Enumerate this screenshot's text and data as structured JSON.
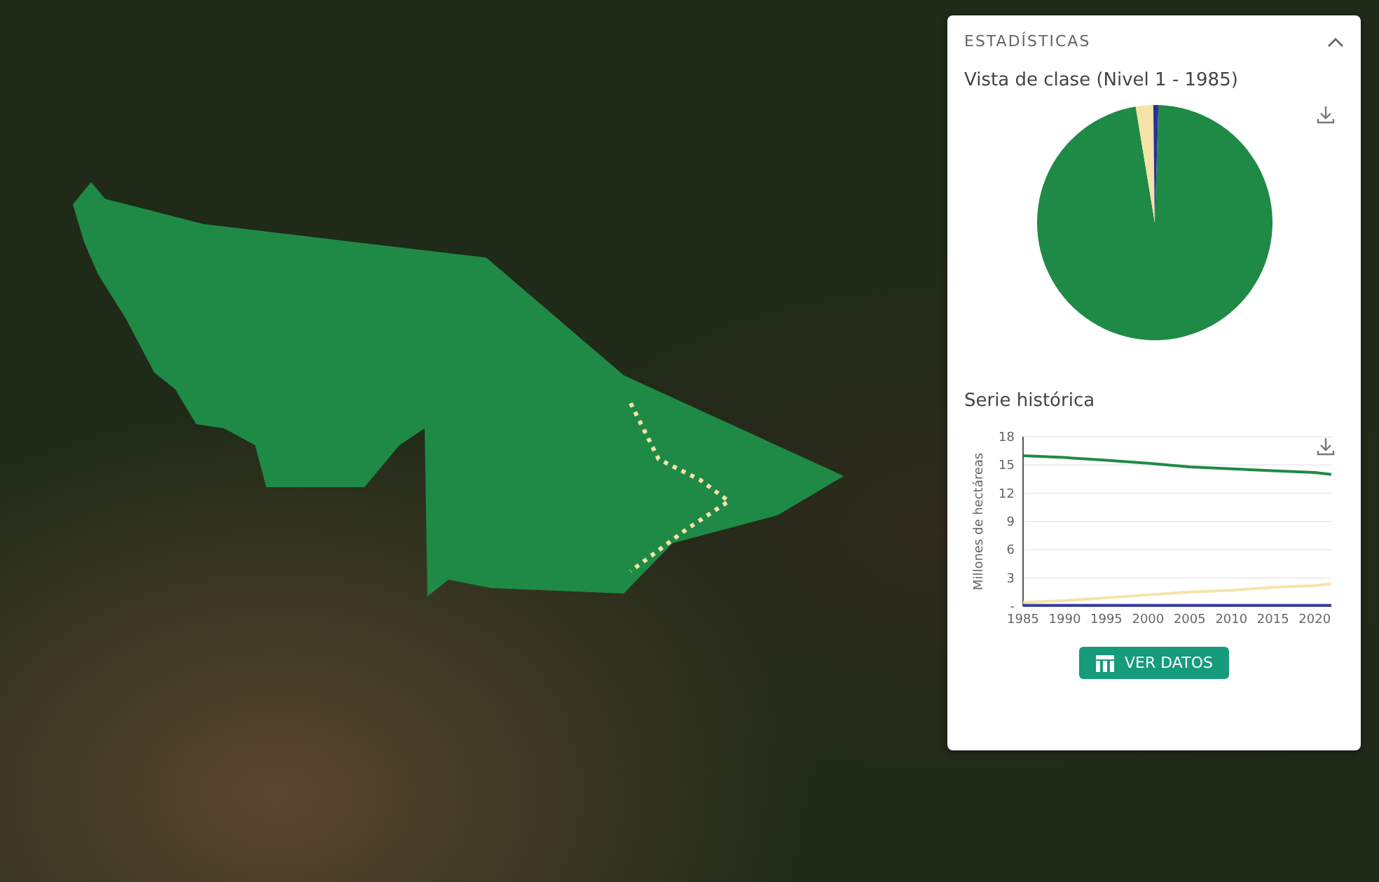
{
  "panel": {
    "title": "ESTADÍSTICAS",
    "expanded": true,
    "pie": {
      "title": "Vista de clase (Nivel 1 - 1985)"
    },
    "history": {
      "title": "Serie histórica",
      "chart_data": {
        "type": "line",
        "ylabel": "Millones de hectáreas",
        "x": [
          1985,
          1990,
          1995,
          2000,
          2005,
          2010,
          2015,
          2020,
          2022
        ],
        "series": [
          {
            "color": "#1f8a45",
            "values": [
              16,
              15.8,
              15.5,
              15.2,
              14.8,
              14.6,
              14.4,
              14.2,
              14.0
            ]
          },
          {
            "color": "#f5e3a8",
            "values": [
              0.4,
              0.6,
              0.9,
              1.2,
              1.5,
              1.7,
              2.0,
              2.2,
              2.4
            ]
          },
          {
            "color": "#3b3fa8",
            "values": [
              0.1,
              0.1,
              0.1,
              0.1,
              0.1,
              0.1,
              0.1,
              0.1,
              0.1
            ]
          }
        ],
        "grid": true,
        "xlim": [
          1985,
          2022
        ],
        "ylim": [
          0,
          18
        ],
        "xticks": [
          1985,
          1990,
          1995,
          2000,
          2005,
          2010,
          2015,
          2020
        ],
        "yticks": [
          {
            "value": 0,
            "label": "-"
          },
          3,
          6,
          9,
          12,
          15,
          18
        ]
      }
    },
    "button": "VER DATOS"
  }
}
